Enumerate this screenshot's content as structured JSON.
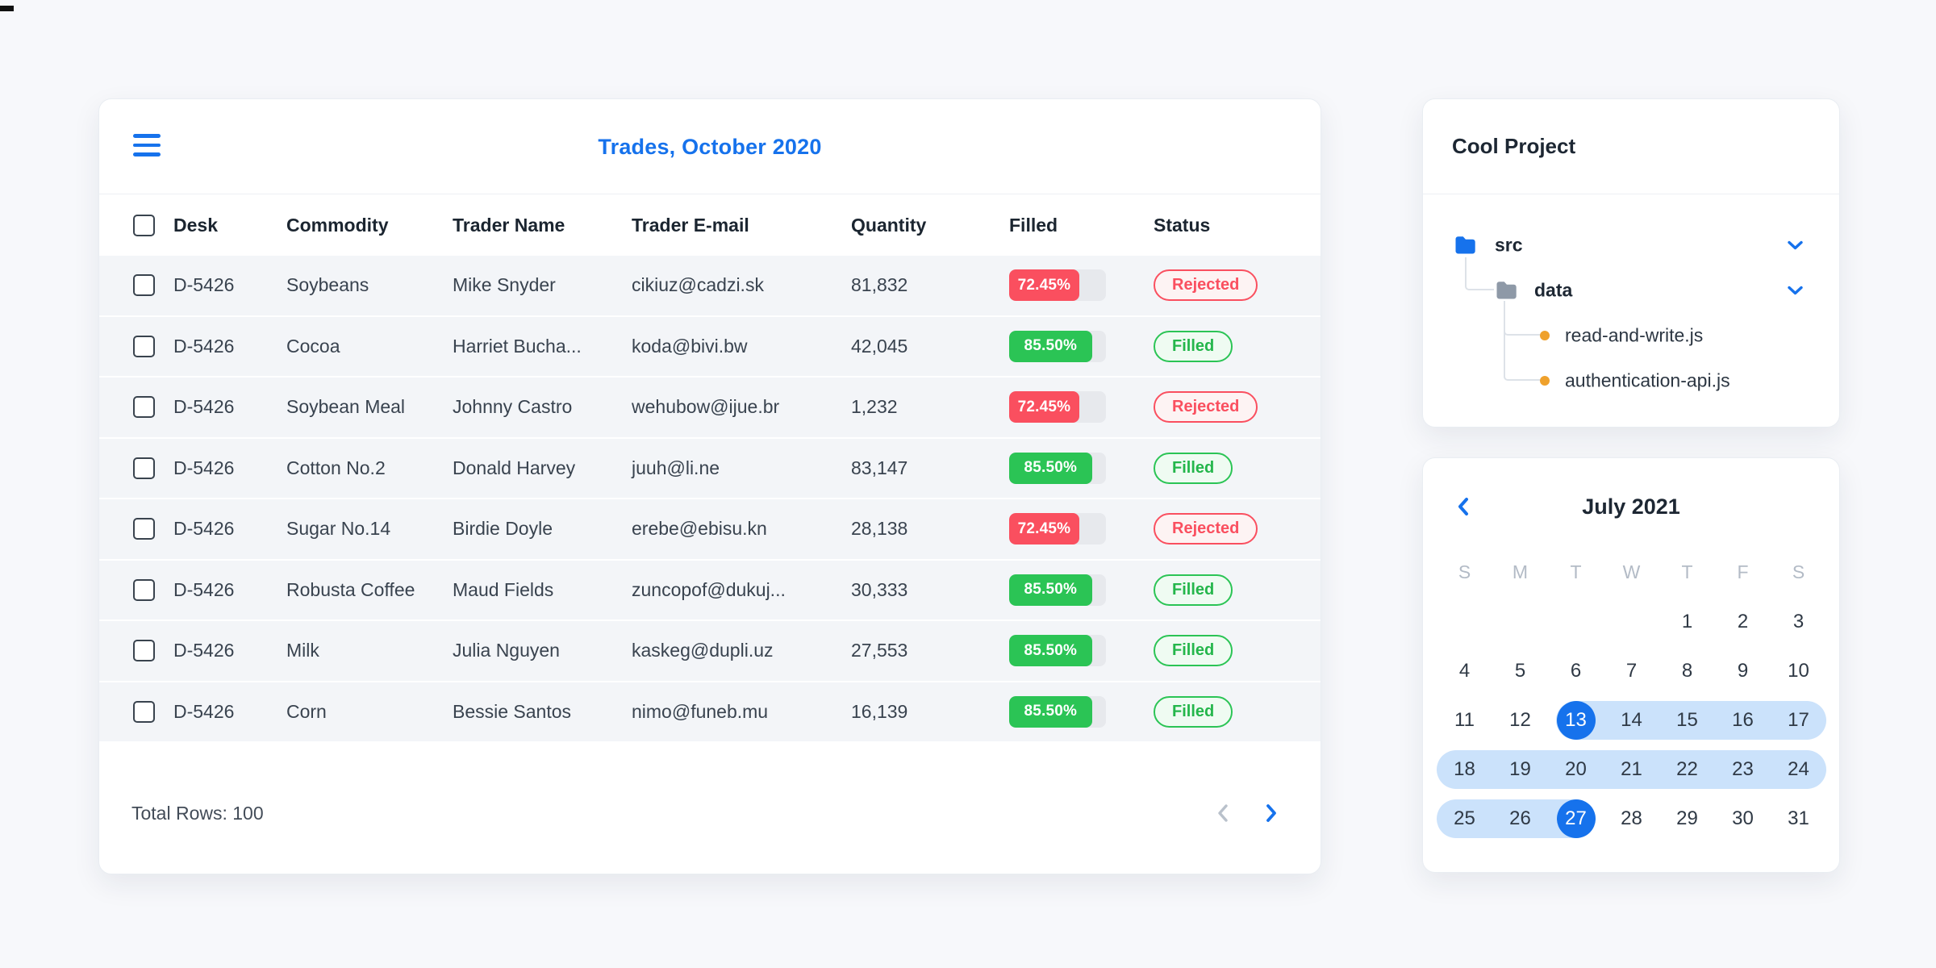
{
  "colors": {
    "accent_blue": "#1672ec",
    "danger_red": "#fa4f5f",
    "success_green": "#2bc455",
    "range_light_blue": "#cbe2fb",
    "row_background": "#f3f5f8"
  },
  "trades": {
    "title": "Trades, October 2020",
    "menu_icon": "hamburger-icon",
    "columns": [
      "Desk",
      "Commodity",
      "Trader Name",
      "Trader E-mail",
      "Quantity",
      "Filled",
      "Status"
    ],
    "rows": [
      {
        "desk": "D-5426",
        "commodity": "Soybeans",
        "trader": "Mike Snyder",
        "email": "cikiuz@cadzi.sk",
        "quantity": "81,832",
        "filled_pct": 72.45,
        "filled_label": "72.45%",
        "status": "Rejected",
        "status_type": "rejected"
      },
      {
        "desk": "D-5426",
        "commodity": "Cocoa",
        "trader": "Harriet Bucha...",
        "email": "koda@bivi.bw",
        "quantity": "42,045",
        "filled_pct": 85.5,
        "filled_label": "85.50%",
        "status": "Filled",
        "status_type": "filled"
      },
      {
        "desk": "D-5426",
        "commodity": "Soybean Meal",
        "trader": "Johnny Castro",
        "email": "wehubow@ijue.br",
        "quantity": "1,232",
        "filled_pct": 72.45,
        "filled_label": "72.45%",
        "status": "Rejected",
        "status_type": "rejected"
      },
      {
        "desk": "D-5426",
        "commodity": "Cotton No.2",
        "trader": "Donald Harvey",
        "email": "juuh@li.ne",
        "quantity": "83,147",
        "filled_pct": 85.5,
        "filled_label": "85.50%",
        "status": "Filled",
        "status_type": "filled"
      },
      {
        "desk": "D-5426",
        "commodity": "Sugar No.14",
        "trader": "Birdie Doyle",
        "email": "erebe@ebisu.kn",
        "quantity": "28,138",
        "filled_pct": 72.45,
        "filled_label": "72.45%",
        "status": "Rejected",
        "status_type": "rejected"
      },
      {
        "desk": "D-5426",
        "commodity": "Robusta Coffee",
        "trader": "Maud Fields",
        "email": "zuncopof@dukuj...",
        "quantity": "30,333",
        "filled_pct": 85.5,
        "filled_label": "85.50%",
        "status": "Filled",
        "status_type": "filled"
      },
      {
        "desk": "D-5426",
        "commodity": "Milk",
        "trader": "Julia Nguyen",
        "email": "kaskeg@dupli.uz",
        "quantity": "27,553",
        "filled_pct": 85.5,
        "filled_label": "85.50%",
        "status": "Filled",
        "status_type": "filled"
      },
      {
        "desk": "D-5426",
        "commodity": "Corn",
        "trader": "Bessie Santos",
        "email": "nimo@funeb.mu",
        "quantity": "16,139",
        "filled_pct": 85.5,
        "filled_label": "85.50%",
        "status": "Filled",
        "status_type": "filled"
      }
    ],
    "footer": {
      "total": "Total Rows: 100",
      "prev_icon": "chevron-left",
      "next_icon": "chevron-right"
    }
  },
  "project": {
    "title": "Cool Project",
    "tree": [
      {
        "label": "src",
        "kind": "folder",
        "icon_color": "#1672ec",
        "level": 0,
        "expandable": true
      },
      {
        "label": "data",
        "kind": "folder",
        "icon_color": "#8e99a7",
        "level": 1,
        "expandable": true
      },
      {
        "label": "read-and-write.js",
        "kind": "file",
        "icon_color": "#efa12c",
        "level": 2,
        "expandable": false
      },
      {
        "label": "authentication-api.js",
        "kind": "file",
        "icon_color": "#efa12c",
        "level": 2,
        "expandable": false
      }
    ]
  },
  "calendar": {
    "month": "July 2021",
    "prev_icon": "chevron-left",
    "weekdays": [
      "S",
      "M",
      "T",
      "W",
      "T",
      "F",
      "S"
    ],
    "weeks": [
      [
        null,
        null,
        null,
        null,
        1,
        2,
        3
      ],
      [
        4,
        5,
        6,
        7,
        8,
        9,
        10
      ],
      [
        11,
        12,
        13,
        14,
        15,
        16,
        17
      ],
      [
        18,
        19,
        20,
        21,
        22,
        23,
        24
      ],
      [
        25,
        26,
        27,
        28,
        29,
        30,
        31
      ]
    ],
    "range_start": 13,
    "range_end": 27
  }
}
